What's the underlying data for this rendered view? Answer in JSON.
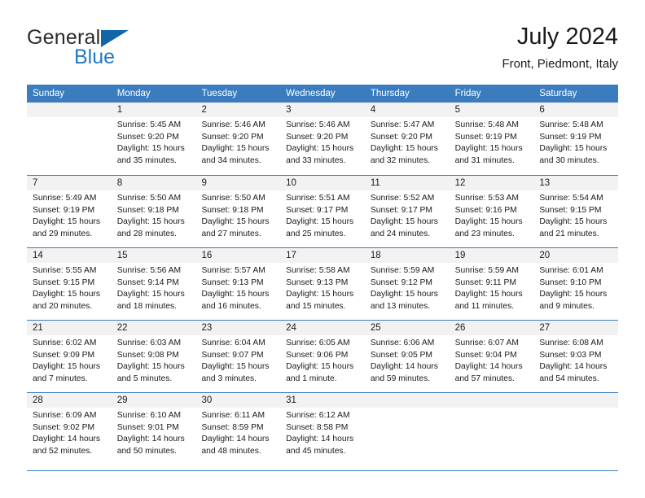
{
  "brand": {
    "name_part1": "General",
    "name_part2": "Blue",
    "triangle_icon": "brand-triangle-icon",
    "colors": {
      "general_text": "#2b2b2b",
      "blue_text": "#2079c8",
      "triangle": "#1464aa"
    }
  },
  "header": {
    "title": "July 2024",
    "subtitle": "Front, Piedmont, Italy"
  },
  "theme": {
    "header_row_bg": "#3b7cbf",
    "header_row_text": "#ffffff",
    "day_band_bg": "#f2f2f2",
    "grid_line": "#3b7cbf"
  },
  "calendar": {
    "weekday_headers": [
      "Sunday",
      "Monday",
      "Tuesday",
      "Wednesday",
      "Thursday",
      "Friday",
      "Saturday"
    ],
    "weeks": [
      [
        {
          "day": "",
          "sunrise": "",
          "sunset": "",
          "daylight_line1": "",
          "daylight_line2": ""
        },
        {
          "day": "1",
          "sunrise": "Sunrise: 5:45 AM",
          "sunset": "Sunset: 9:20 PM",
          "daylight_line1": "Daylight: 15 hours",
          "daylight_line2": "and 35 minutes."
        },
        {
          "day": "2",
          "sunrise": "Sunrise: 5:46 AM",
          "sunset": "Sunset: 9:20 PM",
          "daylight_line1": "Daylight: 15 hours",
          "daylight_line2": "and 34 minutes."
        },
        {
          "day": "3",
          "sunrise": "Sunrise: 5:46 AM",
          "sunset": "Sunset: 9:20 PM",
          "daylight_line1": "Daylight: 15 hours",
          "daylight_line2": "and 33 minutes."
        },
        {
          "day": "4",
          "sunrise": "Sunrise: 5:47 AM",
          "sunset": "Sunset: 9:20 PM",
          "daylight_line1": "Daylight: 15 hours",
          "daylight_line2": "and 32 minutes."
        },
        {
          "day": "5",
          "sunrise": "Sunrise: 5:48 AM",
          "sunset": "Sunset: 9:19 PM",
          "daylight_line1": "Daylight: 15 hours",
          "daylight_line2": "and 31 minutes."
        },
        {
          "day": "6",
          "sunrise": "Sunrise: 5:48 AM",
          "sunset": "Sunset: 9:19 PM",
          "daylight_line1": "Daylight: 15 hours",
          "daylight_line2": "and 30 minutes."
        }
      ],
      [
        {
          "day": "7",
          "sunrise": "Sunrise: 5:49 AM",
          "sunset": "Sunset: 9:19 PM",
          "daylight_line1": "Daylight: 15 hours",
          "daylight_line2": "and 29 minutes."
        },
        {
          "day": "8",
          "sunrise": "Sunrise: 5:50 AM",
          "sunset": "Sunset: 9:18 PM",
          "daylight_line1": "Daylight: 15 hours",
          "daylight_line2": "and 28 minutes."
        },
        {
          "day": "9",
          "sunrise": "Sunrise: 5:50 AM",
          "sunset": "Sunset: 9:18 PM",
          "daylight_line1": "Daylight: 15 hours",
          "daylight_line2": "and 27 minutes."
        },
        {
          "day": "10",
          "sunrise": "Sunrise: 5:51 AM",
          "sunset": "Sunset: 9:17 PM",
          "daylight_line1": "Daylight: 15 hours",
          "daylight_line2": "and 25 minutes."
        },
        {
          "day": "11",
          "sunrise": "Sunrise: 5:52 AM",
          "sunset": "Sunset: 9:17 PM",
          "daylight_line1": "Daylight: 15 hours",
          "daylight_line2": "and 24 minutes."
        },
        {
          "day": "12",
          "sunrise": "Sunrise: 5:53 AM",
          "sunset": "Sunset: 9:16 PM",
          "daylight_line1": "Daylight: 15 hours",
          "daylight_line2": "and 23 minutes."
        },
        {
          "day": "13",
          "sunrise": "Sunrise: 5:54 AM",
          "sunset": "Sunset: 9:15 PM",
          "daylight_line1": "Daylight: 15 hours",
          "daylight_line2": "and 21 minutes."
        }
      ],
      [
        {
          "day": "14",
          "sunrise": "Sunrise: 5:55 AM",
          "sunset": "Sunset: 9:15 PM",
          "daylight_line1": "Daylight: 15 hours",
          "daylight_line2": "and 20 minutes."
        },
        {
          "day": "15",
          "sunrise": "Sunrise: 5:56 AM",
          "sunset": "Sunset: 9:14 PM",
          "daylight_line1": "Daylight: 15 hours",
          "daylight_line2": "and 18 minutes."
        },
        {
          "day": "16",
          "sunrise": "Sunrise: 5:57 AM",
          "sunset": "Sunset: 9:13 PM",
          "daylight_line1": "Daylight: 15 hours",
          "daylight_line2": "and 16 minutes."
        },
        {
          "day": "17",
          "sunrise": "Sunrise: 5:58 AM",
          "sunset": "Sunset: 9:13 PM",
          "daylight_line1": "Daylight: 15 hours",
          "daylight_line2": "and 15 minutes."
        },
        {
          "day": "18",
          "sunrise": "Sunrise: 5:59 AM",
          "sunset": "Sunset: 9:12 PM",
          "daylight_line1": "Daylight: 15 hours",
          "daylight_line2": "and 13 minutes."
        },
        {
          "day": "19",
          "sunrise": "Sunrise: 5:59 AM",
          "sunset": "Sunset: 9:11 PM",
          "daylight_line1": "Daylight: 15 hours",
          "daylight_line2": "and 11 minutes."
        },
        {
          "day": "20",
          "sunrise": "Sunrise: 6:01 AM",
          "sunset": "Sunset: 9:10 PM",
          "daylight_line1": "Daylight: 15 hours",
          "daylight_line2": "and 9 minutes."
        }
      ],
      [
        {
          "day": "21",
          "sunrise": "Sunrise: 6:02 AM",
          "sunset": "Sunset: 9:09 PM",
          "daylight_line1": "Daylight: 15 hours",
          "daylight_line2": "and 7 minutes."
        },
        {
          "day": "22",
          "sunrise": "Sunrise: 6:03 AM",
          "sunset": "Sunset: 9:08 PM",
          "daylight_line1": "Daylight: 15 hours",
          "daylight_line2": "and 5 minutes."
        },
        {
          "day": "23",
          "sunrise": "Sunrise: 6:04 AM",
          "sunset": "Sunset: 9:07 PM",
          "daylight_line1": "Daylight: 15 hours",
          "daylight_line2": "and 3 minutes."
        },
        {
          "day": "24",
          "sunrise": "Sunrise: 6:05 AM",
          "sunset": "Sunset: 9:06 PM",
          "daylight_line1": "Daylight: 15 hours",
          "daylight_line2": "and 1 minute."
        },
        {
          "day": "25",
          "sunrise": "Sunrise: 6:06 AM",
          "sunset": "Sunset: 9:05 PM",
          "daylight_line1": "Daylight: 14 hours",
          "daylight_line2": "and 59 minutes."
        },
        {
          "day": "26",
          "sunrise": "Sunrise: 6:07 AM",
          "sunset": "Sunset: 9:04 PM",
          "daylight_line1": "Daylight: 14 hours",
          "daylight_line2": "and 57 minutes."
        },
        {
          "day": "27",
          "sunrise": "Sunrise: 6:08 AM",
          "sunset": "Sunset: 9:03 PM",
          "daylight_line1": "Daylight: 14 hours",
          "daylight_line2": "and 54 minutes."
        }
      ],
      [
        {
          "day": "28",
          "sunrise": "Sunrise: 6:09 AM",
          "sunset": "Sunset: 9:02 PM",
          "daylight_line1": "Daylight: 14 hours",
          "daylight_line2": "and 52 minutes."
        },
        {
          "day": "29",
          "sunrise": "Sunrise: 6:10 AM",
          "sunset": "Sunset: 9:01 PM",
          "daylight_line1": "Daylight: 14 hours",
          "daylight_line2": "and 50 minutes."
        },
        {
          "day": "30",
          "sunrise": "Sunrise: 6:11 AM",
          "sunset": "Sunset: 8:59 PM",
          "daylight_line1": "Daylight: 14 hours",
          "daylight_line2": "and 48 minutes."
        },
        {
          "day": "31",
          "sunrise": "Sunrise: 6:12 AM",
          "sunset": "Sunset: 8:58 PM",
          "daylight_line1": "Daylight: 14 hours",
          "daylight_line2": "and 45 minutes."
        },
        {
          "day": "",
          "sunrise": "",
          "sunset": "",
          "daylight_line1": "",
          "daylight_line2": ""
        },
        {
          "day": "",
          "sunrise": "",
          "sunset": "",
          "daylight_line1": "",
          "daylight_line2": ""
        },
        {
          "day": "",
          "sunrise": "",
          "sunset": "",
          "daylight_line1": "",
          "daylight_line2": ""
        }
      ]
    ]
  }
}
